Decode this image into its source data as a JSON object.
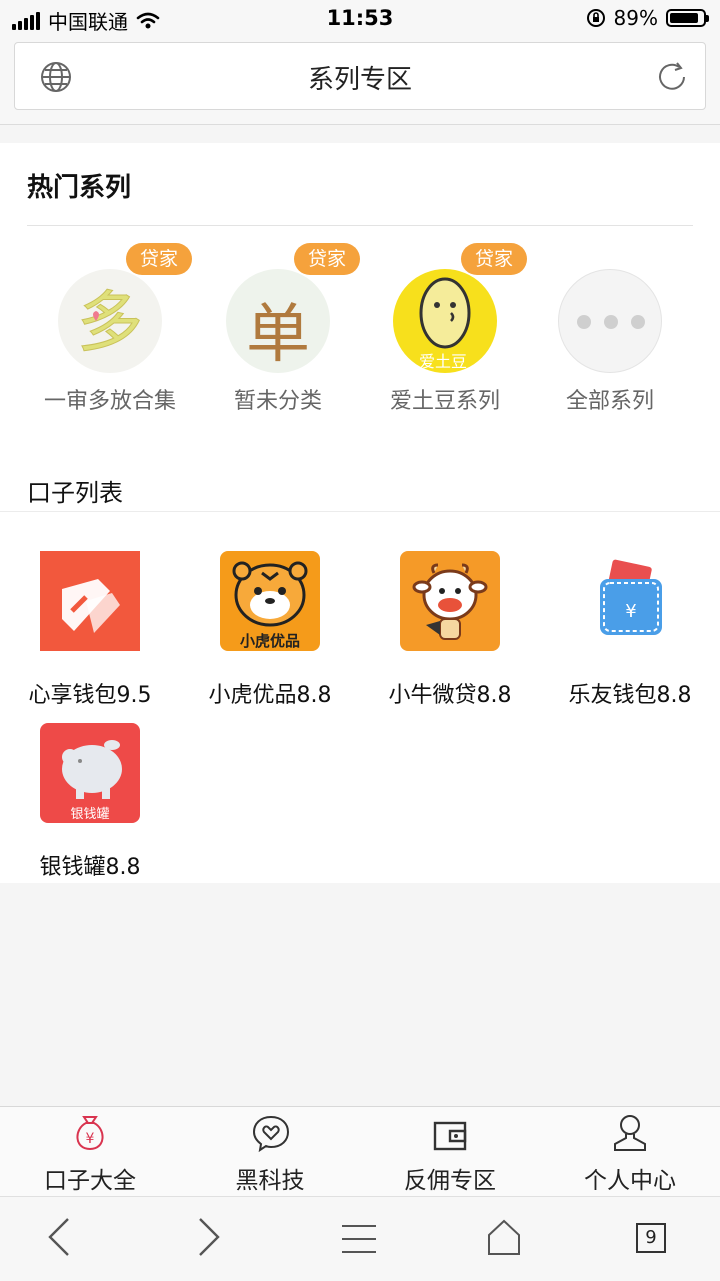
{
  "status_bar": {
    "carrier": "中国联通",
    "time": "11:53",
    "battery_percent": "89%",
    "battery_level": 0.89
  },
  "url_bar": {
    "title": "系列专区",
    "left_icon": "globe-icon",
    "right_icon": "reload-icon"
  },
  "hot_series": {
    "title": "热门系列",
    "items": [
      {
        "label": "一审多放合集",
        "badge": "贷家",
        "glyph": "多"
      },
      {
        "label": "暂未分类",
        "badge": "贷家",
        "glyph": "单"
      },
      {
        "label": "爱土豆系列",
        "badge": "贷家",
        "glyph": "爱土豆"
      },
      {
        "label": "全部系列",
        "badge": ""
      }
    ]
  },
  "loan_list": {
    "title": "口子列表",
    "items": [
      {
        "name": "心享钱包9.5"
      },
      {
        "name": "小虎优品8.8",
        "icon_text": "小虎优品"
      },
      {
        "name": "小牛微贷8.8"
      },
      {
        "name": "乐友钱包8.8"
      },
      {
        "name": "银钱罐8.8",
        "icon_text": "银钱罐"
      }
    ]
  },
  "tabbar": {
    "items": [
      {
        "label": "口子大全",
        "icon": "money-bag-icon",
        "active": true
      },
      {
        "label": "黑科技",
        "icon": "heart-chat-icon"
      },
      {
        "label": "反佣专区",
        "icon": "wallet-icon"
      },
      {
        "label": "个人中心",
        "icon": "person-icon"
      }
    ]
  },
  "browser_toolbar": {
    "tab_count": "9",
    "icons": [
      "back-icon",
      "forward-icon",
      "menu-icon",
      "home-icon",
      "tabs-icon"
    ]
  },
  "colors": {
    "badge": "#f5a23c",
    "active_tab_icon": "#d9344f"
  }
}
